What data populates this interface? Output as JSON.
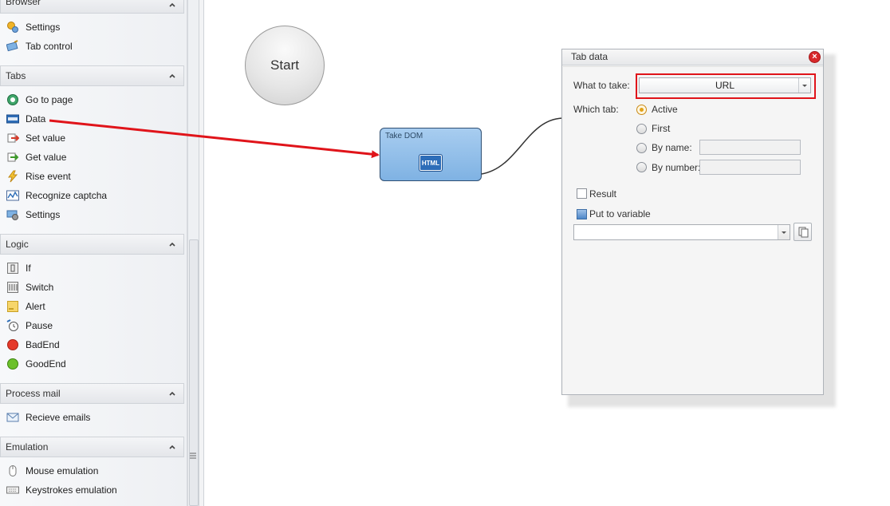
{
  "sidebar": {
    "sections": [
      {
        "title": "Browser",
        "items": [
          {
            "label": "Settings",
            "icon": "settings-gears-icon"
          },
          {
            "label": "Tab control",
            "icon": "tab-control-icon"
          }
        ]
      },
      {
        "title": "Tabs",
        "items": [
          {
            "label": "Go to page",
            "icon": "go-to-page-icon"
          },
          {
            "label": "Data",
            "icon": "html-icon"
          },
          {
            "label": "Set value",
            "icon": "set-value-icon"
          },
          {
            "label": "Get value",
            "icon": "get-value-icon"
          },
          {
            "label": "Rise event",
            "icon": "lightning-icon"
          },
          {
            "label": "Recognize captcha",
            "icon": "captcha-icon"
          },
          {
            "label": "Settings",
            "icon": "tab-settings-icon"
          }
        ]
      },
      {
        "title": "Logic",
        "items": [
          {
            "label": "If",
            "icon": "if-icon"
          },
          {
            "label": "Switch",
            "icon": "switch-icon"
          },
          {
            "label": "Alert",
            "icon": "alert-icon"
          },
          {
            "label": "Pause",
            "icon": "pause-icon"
          },
          {
            "label": "BadEnd",
            "icon": "bad-end-icon"
          },
          {
            "label": "GoodEnd",
            "icon": "good-end-icon"
          }
        ]
      },
      {
        "title": "Process mail",
        "items": [
          {
            "label": "Recieve emails",
            "icon": "mail-icon"
          }
        ]
      },
      {
        "title": "Emulation",
        "items": [
          {
            "label": "Mouse emulation",
            "icon": "mouse-icon"
          },
          {
            "label": "Keystrokes emulation",
            "icon": "keyboard-icon"
          }
        ]
      }
    ]
  },
  "canvas": {
    "start_label": "Start",
    "node_title": "Take DOM",
    "node_badge": "HTML"
  },
  "dialog": {
    "title": "Tab data",
    "what_label": "What to take:",
    "what_value": "URL",
    "which_label": "Which tab:",
    "radios": [
      {
        "label": "Active",
        "selected": true
      },
      {
        "label": "First",
        "selected": false
      },
      {
        "label": "By name:",
        "selected": false
      },
      {
        "label": "By number:",
        "selected": false
      }
    ],
    "by_name_value": "",
    "by_number_value": "",
    "result_label": "Result",
    "result_checked": false,
    "put_var_label": "Put to variable",
    "variable_value": ""
  },
  "colors": {
    "highlight": "#e0141a",
    "node_fill": "#8fbde8",
    "radio_selected": "#e3a21a"
  }
}
